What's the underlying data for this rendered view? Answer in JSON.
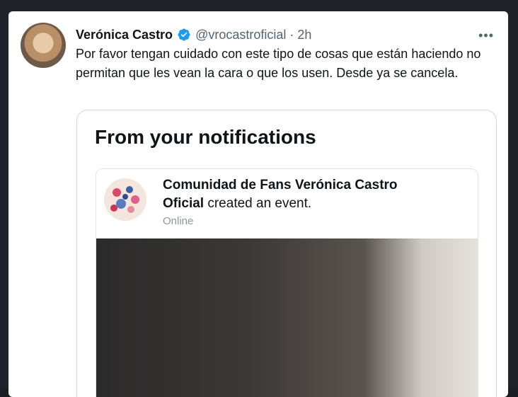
{
  "tweet": {
    "author_name": "Verónica Castro",
    "handle_time": "@vrocastroficial · 2h",
    "more_icon": "more-dots-icon",
    "text": "Por favor tengan cuidado con este tipo de cosas que están haciendo no permitan que les vean la cara o que los usen. Desde ya se cancela."
  },
  "quote": {
    "title": "From your notifications",
    "notification": {
      "group_name_line1": "Comunidad de Fans Verónica Castro",
      "group_name_line2_bold": "Oficial",
      "action_text": " created an event.",
      "subtitle": "Online"
    }
  },
  "colors": {
    "verified_blue": "#1d9bf0",
    "text_primary": "#0f1419",
    "text_secondary": "#536471",
    "border": "#cfd9de"
  }
}
